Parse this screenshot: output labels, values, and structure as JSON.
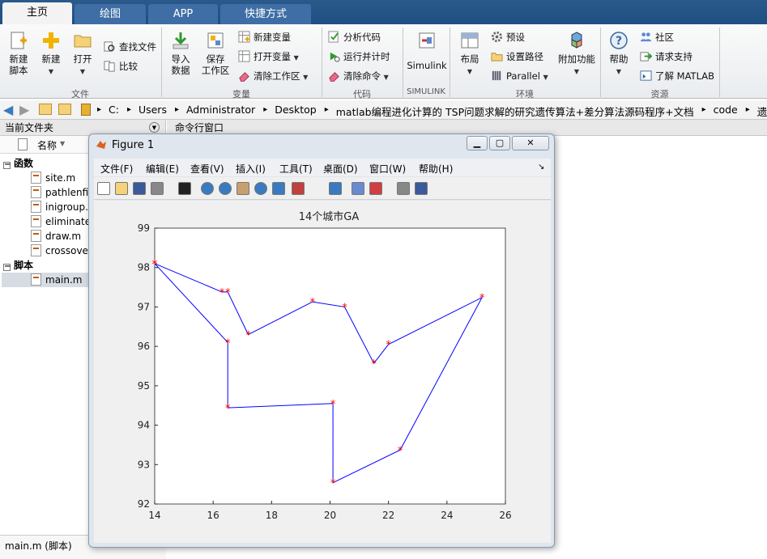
{
  "tabs": [
    {
      "label": "主页",
      "active": true
    },
    {
      "label": "绘图",
      "active": false
    },
    {
      "label": "APP",
      "active": false
    },
    {
      "label": "快捷方式",
      "active": false
    }
  ],
  "ribbon": {
    "file": {
      "new_script": "新建\n脚本",
      "new": "新建",
      "open": "打开",
      "find_files": "查找文件",
      "compare": "比较",
      "group": "文件"
    },
    "variable": {
      "import": "导入\n数据",
      "save_ws": "保存\n工作区",
      "new_var": "新建变量",
      "open_var": "打开变量",
      "clear_ws": "清除工作区",
      "group": "变量"
    },
    "code": {
      "analyze": "分析代码",
      "run_time": "运行并计时",
      "clear_cmd": "清除命令",
      "group": "代码"
    },
    "simulink": {
      "label": "Simulink",
      "group": "SIMULINK"
    },
    "env": {
      "layout": "布局",
      "prefs": "预设",
      "set_path": "设置路径",
      "parallel": "Parallel",
      "addons": "附加功能",
      "group": "环境"
    },
    "resources": {
      "help": "帮助",
      "community": "社区",
      "support": "请求支持",
      "learn": "了解 MATLAB",
      "group": "资源"
    }
  },
  "address": {
    "crumbs": [
      "C:",
      "Users",
      "Administrator",
      "Desktop",
      "matlab编程进化计算的 TSP问题求解的研究遗传算法+差分算法源码程序+文档",
      "code",
      "遗传算法"
    ]
  },
  "left_panel": {
    "title": "当前文件夹",
    "col_name": "名称",
    "cat_functions": "函数",
    "functions": [
      "site.m",
      "pathlenfit",
      "inigroup.",
      "eliminate",
      "draw.m",
      "crossove"
    ],
    "cat_scripts": "脚本",
    "scripts": [
      "main.m"
    ],
    "status": "main.m  (脚本)"
  },
  "right_panel": {
    "title": "命令行窗口"
  },
  "figure": {
    "title": "Figure 1",
    "menu": [
      "文件(F)",
      "编辑(E)",
      "查看(V)",
      "插入(I)",
      "工具(T)",
      "桌面(D)",
      "窗口(W)",
      "帮助(H)"
    ],
    "toolbar_icons": [
      "new-figure-icon",
      "open-icon",
      "save-icon",
      "print-icon",
      "pointer-icon",
      "zoom-in-icon",
      "zoom-out-icon",
      "pan-icon",
      "rotate-icon",
      "data-cursor-icon",
      "brush-icon",
      "link-icon",
      "colorbar-icon",
      "legend-icon",
      "hide-tools-icon",
      "dock-icon"
    ]
  },
  "chart_data": {
    "type": "line",
    "title": "14个城市GA",
    "xlabel": "",
    "ylabel": "",
    "xlim": [
      14,
      26
    ],
    "ylim": [
      92,
      99
    ],
    "xticks": [
      14,
      16,
      18,
      20,
      22,
      24,
      26
    ],
    "yticks": [
      92,
      93,
      94,
      95,
      96,
      97,
      98,
      99
    ],
    "grid": false,
    "line_color": "#0000ff",
    "marker_color": "#ff0000",
    "marker": "*",
    "series": [
      {
        "x": [
          14,
          16.3,
          16.5,
          17.2,
          19.4,
          20.5,
          21.5,
          22.0,
          25.2,
          22.4,
          20.1,
          20.1,
          16.5,
          16.5,
          14
        ],
        "y": [
          98.1,
          97.38,
          97.38,
          96.3,
          97.13,
          97.0,
          95.57,
          96.05,
          97.24,
          93.37,
          92.54,
          94.55,
          94.44,
          96.1,
          98.1
        ]
      }
    ]
  }
}
